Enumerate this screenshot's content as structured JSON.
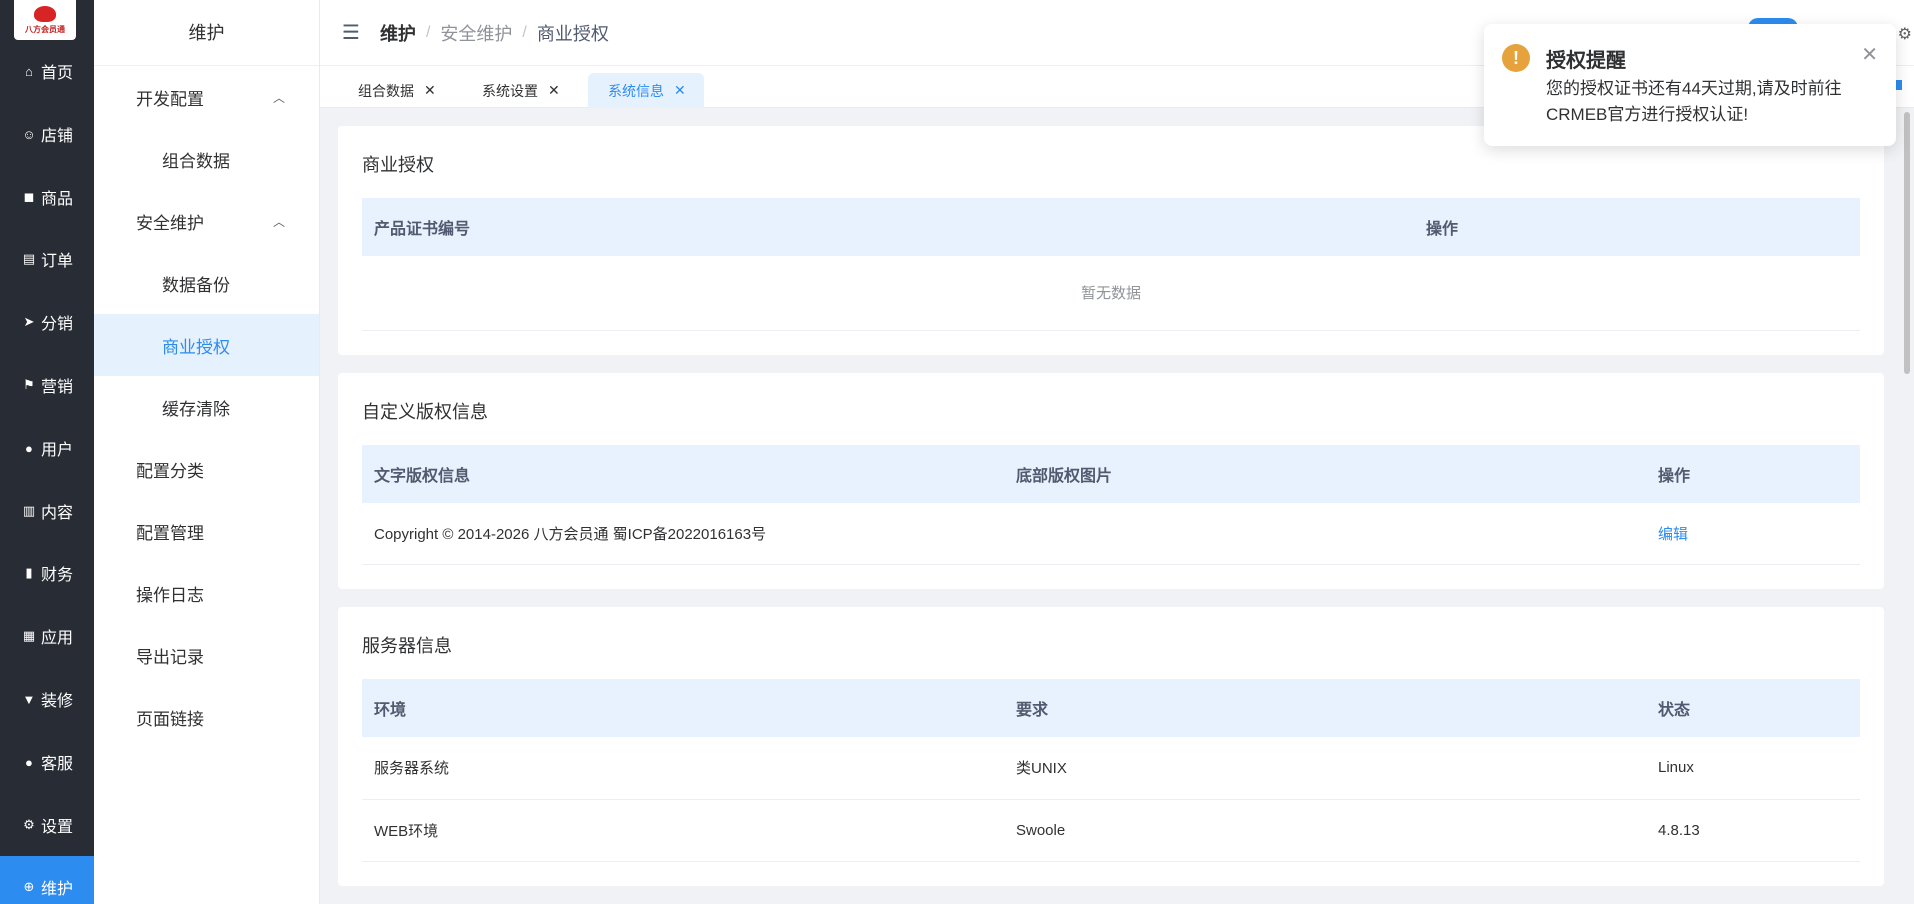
{
  "logo": {
    "text": "八方会员通"
  },
  "rail": {
    "items": [
      {
        "label": "首页",
        "icon": "⌂",
        "name": "home"
      },
      {
        "label": "店铺",
        "icon": "☺",
        "name": "store"
      },
      {
        "label": "商品",
        "icon": "◼",
        "name": "product"
      },
      {
        "label": "订单",
        "icon": "▤",
        "name": "order"
      },
      {
        "label": "分销",
        "icon": "➤",
        "name": "distribution"
      },
      {
        "label": "营销",
        "icon": "⚑",
        "name": "marketing"
      },
      {
        "label": "用户",
        "icon": "●",
        "name": "user"
      },
      {
        "label": "内容",
        "icon": "▥",
        "name": "content"
      },
      {
        "label": "财务",
        "icon": "▮",
        "name": "finance"
      },
      {
        "label": "应用",
        "icon": "▦",
        "name": "apps"
      },
      {
        "label": "装修",
        "icon": "▼",
        "name": "decorate"
      },
      {
        "label": "客服",
        "icon": "●",
        "name": "service"
      },
      {
        "label": "设置",
        "icon": "⚙",
        "name": "settings"
      },
      {
        "label": "维护",
        "icon": "⊕",
        "name": "maintain"
      }
    ]
  },
  "submenu": {
    "title": "维护",
    "group1": "开发配置",
    "group1_child1": "组合数据",
    "group2": "安全维护",
    "group2_child1": "数据备份",
    "group2_child2": "商业授权",
    "group2_child3": "缓存清除",
    "item_config_category": "配置分类",
    "item_config_manage": "配置管理",
    "item_op_log": "操作日志",
    "item_export": "导出记录",
    "item_page_link": "页面链接"
  },
  "header": {
    "crumb1": "维护",
    "crumb2": "安全维护",
    "crumb3": "商业授权",
    "sep": "/"
  },
  "tabs": [
    {
      "label": "组合数据",
      "close": "✕"
    },
    {
      "label": "系统设置",
      "close": "✕"
    },
    {
      "label": "系统信息",
      "close": "✕"
    }
  ],
  "cards": {
    "license": {
      "title": "商业授权",
      "col1": "产品证书编号",
      "col2": "操作",
      "empty": "暂无数据"
    },
    "copyright": {
      "title": "自定义版权信息",
      "col1": "文字版权信息",
      "col2": "底部版权图片",
      "col3": "操作",
      "row_text": "Copyright © 2014-2026 八方会员通 蜀ICP备2022016163号",
      "row_action": "编辑"
    },
    "server": {
      "title": "服务器信息",
      "col1": "环境",
      "col2": "要求",
      "col3": "状态",
      "rows": [
        {
          "env": "服务器系统",
          "req": "类UNIX",
          "status": "Linux"
        },
        {
          "env": "WEB环境",
          "req": "Swoole",
          "status": "4.8.13"
        }
      ]
    }
  },
  "notice": {
    "icon": "!",
    "title": "授权提醒",
    "body": "您的授权证书还有44天过期,请及时前往CRMEB官方进行授权认证!",
    "close": "✕"
  },
  "colors": {
    "accent": "#2d8cf0",
    "rail_bg": "#282c34",
    "warn": "#e6a23c"
  }
}
